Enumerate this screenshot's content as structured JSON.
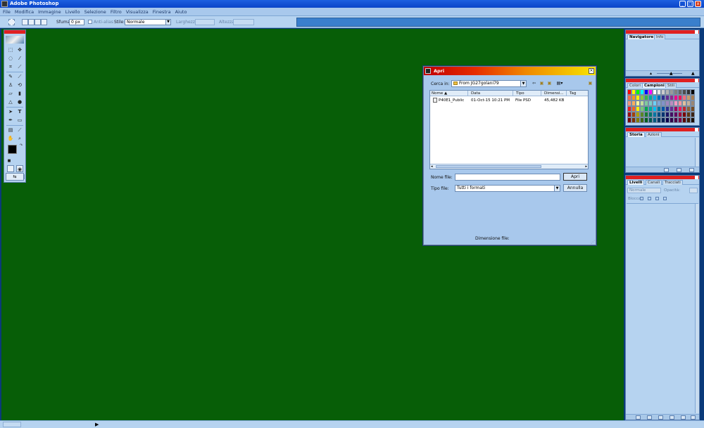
{
  "app": {
    "title": "Adobe Photoshop"
  },
  "menu": [
    "File",
    "Modifica",
    "Immagine",
    "Livello",
    "Selezione",
    "Filtro",
    "Visualizza",
    "Finestra",
    "Aiuto"
  ],
  "options_bar": {
    "feather_label": "Sfuma:",
    "feather_value": "0 px",
    "antialias_label": "Anti-alias",
    "style_label": "Stile:",
    "style_value": "Normale",
    "width_label": "Larghezza:",
    "height_label": "Altezza:"
  },
  "panels": {
    "navigator": {
      "tabs": [
        "Navigatore",
        "Info"
      ]
    },
    "swatches": {
      "tabs": [
        "Colori",
        "Campioni",
        "Stili"
      ],
      "colors": [
        "#ff0000",
        "#ffff00",
        "#00ff00",
        "#00ffff",
        "#0000ff",
        "#ff00ff",
        "#ffffff",
        "#e6e6e6",
        "#cccccc",
        "#b3b3b3",
        "#999999",
        "#808080",
        "#666666",
        "#4d4d4d",
        "#333333",
        "#000000",
        "#f26c4f",
        "#f7941d",
        "#fff200",
        "#8dc63f",
        "#39b54a",
        "#00a99d",
        "#00aeef",
        "#0072bc",
        "#2e3192",
        "#662d91",
        "#92278f",
        "#ec008c",
        "#ed145b",
        "#f26d7d",
        "#c69c6d",
        "#a67c52",
        "#f69679",
        "#fbaf5d",
        "#fff799",
        "#c4df9b",
        "#82ca9c",
        "#7accc8",
        "#6dcff6",
        "#7ea7d8",
        "#8393ca",
        "#a186be",
        "#bd8cbf",
        "#f49ac2",
        "#f5989d",
        "#e0c09c",
        "#c7b299",
        "#998675",
        "#ed1c24",
        "#f26522",
        "#ffef00",
        "#7cc576",
        "#00a651",
        "#00a99d",
        "#00bff3",
        "#0076a3",
        "#0054a6",
        "#2e3192",
        "#662d91",
        "#9e005d",
        "#ed145b",
        "#c1272d",
        "#8c6239",
        "#754c24",
        "#9e0b0f",
        "#a0410d",
        "#aba000",
        "#598527",
        "#197b30",
        "#00746b",
        "#0076a3",
        "#004a80",
        "#003471",
        "#1b1464",
        "#440e62",
        "#630460",
        "#9e0039",
        "#790000",
        "#603813",
        "#3c2415",
        "#790000",
        "#7b2e00",
        "#827b00",
        "#406618",
        "#005e20",
        "#005952",
        "#005b7f",
        "#003663",
        "#002157",
        "#0d004c",
        "#32004b",
        "#4b0049",
        "#7b0046",
        "#5c0000",
        "#42210b",
        "#1a0f06"
      ]
    },
    "history": {
      "tabs": [
        "Storia",
        "Azioni"
      ]
    },
    "layers": {
      "tabs": [
        "Livelli",
        "Canali",
        "Tracciati"
      ],
      "blend_mode": "Normale",
      "opacity_label": "Opacità:",
      "lock_label": "Blocca:"
    }
  },
  "dialog": {
    "title": "Apri",
    "look_in_label": "Cerca in:",
    "look_in_value": "From JG27golani79",
    "columns": [
      "Nome",
      "Data",
      "Tipo",
      "Dimensi...",
      "Tag"
    ],
    "files": [
      {
        "name": "P40E1_Public",
        "date": "01-Oct-15 10:21 PM",
        "type": "File PSD",
        "size": "45,482 KB",
        "tag": ""
      }
    ],
    "filename_label": "Nome file:",
    "filename_value": "",
    "filetype_label": "Tipo file:",
    "filetype_value": "Tutti i formati",
    "open_button": "Apri",
    "cancel_button": "Annulla",
    "file_size_label": "Dimensione file:"
  }
}
